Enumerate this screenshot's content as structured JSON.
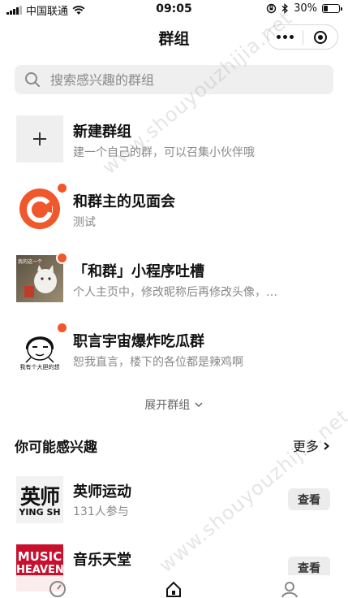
{
  "status_bar": {
    "carrier": "中国联通",
    "time": "09:05",
    "battery": "30%",
    "battery_level": 0.3
  },
  "nav": {
    "title": "群组"
  },
  "search": {
    "placeholder": "搜索感兴趣的群组"
  },
  "groups": [
    {
      "title": "新建群组",
      "subtitle": "建一个自己的群，可以召集小伙伴哦",
      "has_red_dot": false,
      "avatar_icon": "plus-icon"
    },
    {
      "title": "和群主的见面会",
      "subtitle": "测试",
      "has_red_dot": true,
      "avatar_icon": "app-logo-icon"
    },
    {
      "title": "「和群」小程序吐槽",
      "subtitle": "个人主页中，修改昵称后再修改头像，…",
      "has_red_dot": true,
      "avatar_icon": "cat-photo"
    },
    {
      "title": "职言宇宙爆炸吃瓜群",
      "subtitle": "恕我直言，楼下的各位都是辣鸡啊",
      "has_red_dot": true,
      "avatar_icon": "meme-face",
      "avatar_caption": "我有个大胆的想"
    }
  ],
  "expand_label": "展开群组",
  "recommend": {
    "title": "你可能感兴趣",
    "more_label": "更多",
    "items": [
      {
        "title": "英师运动",
        "subtitle": "131人参与",
        "button": "查看",
        "logo_line1": "英师",
        "logo_line2": "YING SH"
      },
      {
        "title": "音乐天堂",
        "subtitle": "",
        "button": "查看",
        "logo_line1": "MUSIC",
        "logo_line2": "HEAVEN"
      }
    ]
  },
  "cat_caption": "我的这一个",
  "watermark": "www.shouyouzhijia.net",
  "colors": {
    "accent": "#f0572a",
    "search_bg": "#efefef",
    "button_bg": "#ececec",
    "music_red": "#c8102e"
  }
}
